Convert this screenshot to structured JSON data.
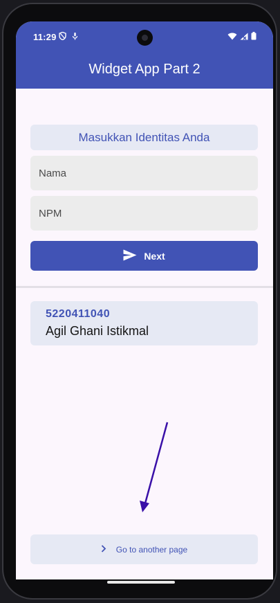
{
  "status_bar": {
    "time": "11:29"
  },
  "appbar": {
    "title": "Widget App Part 2"
  },
  "form": {
    "header_label": "Masukkan Identitas Anda",
    "nama_placeholder": "Nama",
    "npm_placeholder": "NPM",
    "next_label": "Next"
  },
  "identity": {
    "npm": "5220411040",
    "name": "Agil Ghani Istikmal"
  },
  "footer": {
    "goto_label": "Go to another page"
  },
  "colors": {
    "primary": "#4153b5",
    "card_bg": "#e6e9f4",
    "field_bg": "#ececec",
    "screen_bg": "#fcf6fd",
    "annotation_arrow": "#3a10a8"
  },
  "icons": {
    "status_left": [
      "shield-icon",
      "download-icon"
    ],
    "status_right": [
      "wifi-icon",
      "signal-icon",
      "battery-icon"
    ],
    "next_button": "send-icon",
    "goto_button": "chevron-right-icon"
  }
}
